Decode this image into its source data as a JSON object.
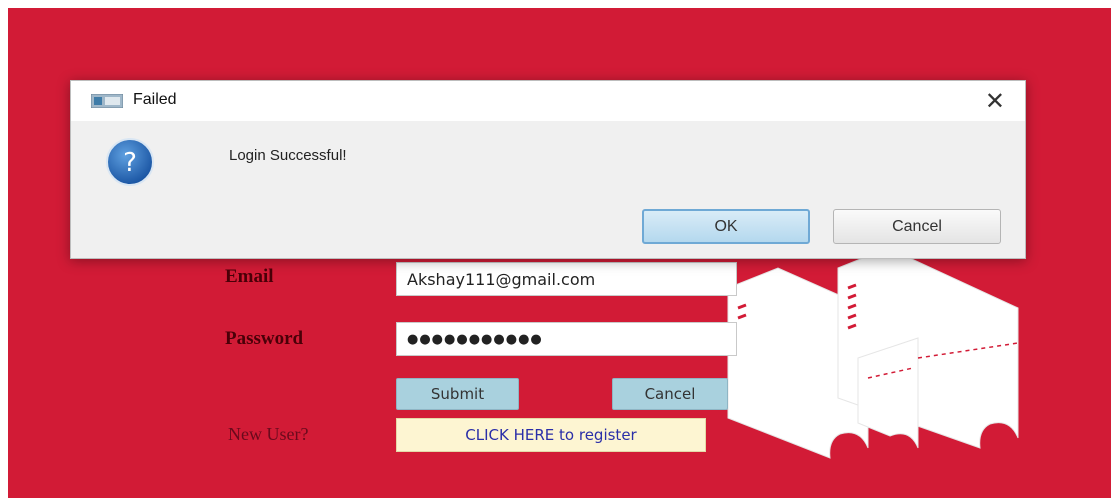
{
  "login_form": {
    "email_label": "Email",
    "email_value": "Akshay111@gmail.com",
    "password_label": "Password",
    "password_value": "●●●●●●●●●●●",
    "submit_label": "Submit",
    "cancel_label": "Cancel",
    "new_user_label": "New User?",
    "register_label": "CLICK HERE to register"
  },
  "dialog": {
    "title": "Failed",
    "close_glyph": "✕",
    "message": "Login Successful!",
    "question_glyph": "?",
    "ok_label": "OK",
    "cancel_label": "Cancel"
  },
  "colors": {
    "background": "#d21b36",
    "button_bg": "#a9d1de",
    "register_bg": "#fdf5d2"
  },
  "icons": [
    "ticket-art-icon",
    "question-icon",
    "window-icon",
    "close-icon"
  ]
}
